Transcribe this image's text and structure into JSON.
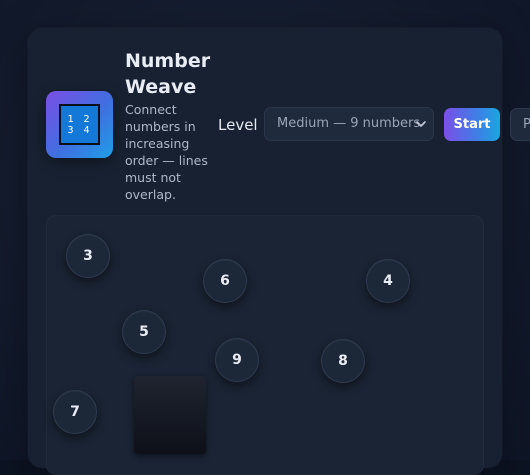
{
  "header": {
    "title_line1": "Number",
    "title_line2": "Weave",
    "description": "Connect numbers in increasing order — lines must not overlap.",
    "logo_digits_row1": "1 2",
    "logo_digits_row2": "3 4"
  },
  "controls": {
    "level_label": "Level",
    "level_selected": "Medium — 9 numbers",
    "start_label": "Start",
    "partial_button_label": "P"
  },
  "board": {
    "nodes": [
      {
        "id": "node-3",
        "label": "3"
      },
      {
        "id": "node-6",
        "label": "6"
      },
      {
        "id": "node-4",
        "label": "4"
      },
      {
        "id": "node-5",
        "label": "5"
      },
      {
        "id": "node-9",
        "label": "9"
      },
      {
        "id": "node-8",
        "label": "8"
      },
      {
        "id": "node-7",
        "label": "7"
      }
    ]
  },
  "colors": {
    "accent_start": "#7b4fe6",
    "accent_end": "#1aa6e0",
    "panel_bg": "#172131",
    "node_bg": "#1c2737"
  }
}
